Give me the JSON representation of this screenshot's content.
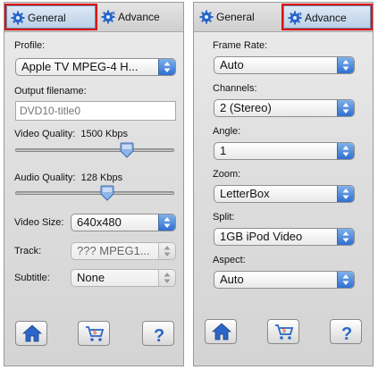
{
  "left_panel": {
    "tabs": [
      {
        "label": "General",
        "icon": "gear-icon",
        "selected": true
      },
      {
        "label": "Advance",
        "icon": "gear-plus-icon",
        "selected": false
      }
    ],
    "profile": {
      "label": "Profile:",
      "value": "Apple TV MPEG-4 H..."
    },
    "output_filename": {
      "label": "Output filename:",
      "placeholder": "DVD10-title0"
    },
    "video_quality": {
      "label": "Video Quality:",
      "value": "1500 Kbps",
      "level": 0.7
    },
    "audio_quality": {
      "label": "Audio Quality:",
      "value": "128 Kbps",
      "level": 0.58
    },
    "video_size": {
      "label": "Video Size:",
      "value": "640x480"
    },
    "track": {
      "label": "Track:",
      "value": "??? MPEG1..."
    },
    "subtitle": {
      "label": "Subtitle:",
      "value": "None"
    },
    "buttons": [
      {
        "name": "home",
        "icon": "home-icon"
      },
      {
        "name": "cart",
        "icon": "cart-icon"
      },
      {
        "name": "help",
        "icon": "help-icon",
        "label": "?"
      }
    ]
  },
  "right_panel": {
    "tabs": [
      {
        "label": "General",
        "icon": "gear-icon",
        "selected": false
      },
      {
        "label": "Advance",
        "icon": "gear-plus-icon",
        "selected": true
      }
    ],
    "frame_rate": {
      "label": "Frame Rate:",
      "value": "Auto"
    },
    "channels": {
      "label": "Channels:",
      "value": "2 (Stereo)"
    },
    "angle": {
      "label": "Angle:",
      "value": "1"
    },
    "zoom": {
      "label": "Zoom:",
      "value": "LetterBox"
    },
    "split": {
      "label": "Split:",
      "value": "1GB iPod Video"
    },
    "aspect": {
      "label": "Aspect:",
      "value": "Auto"
    },
    "buttons": [
      {
        "name": "home",
        "icon": "home-icon"
      },
      {
        "name": "cart",
        "icon": "cart-icon"
      },
      {
        "name": "help",
        "icon": "help-icon",
        "label": "?"
      }
    ]
  },
  "colors": {
    "highlight": "#dd1111",
    "select_arrow": "#2f6fd0",
    "icon_blue": "#2a66c8"
  }
}
